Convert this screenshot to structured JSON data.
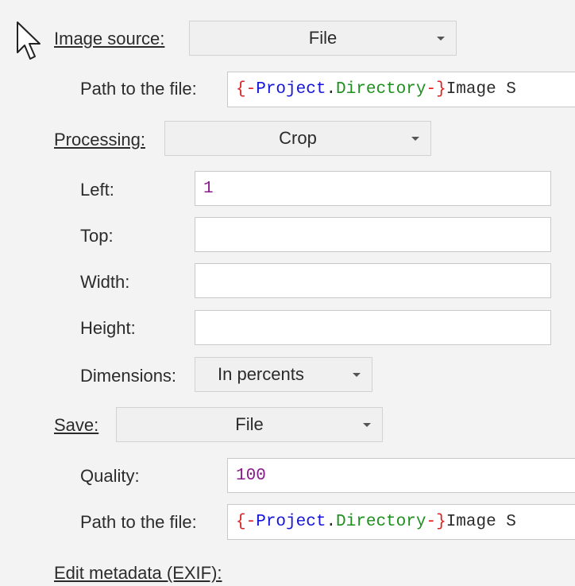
{
  "image_source": {
    "label": "Image source:",
    "value": "File",
    "path_label": "Path to the file:",
    "path": {
      "open": "{-",
      "project": "Project",
      "dot": ".",
      "directory": "Directory",
      "close": "-}",
      "rest": "Image S"
    }
  },
  "processing": {
    "label": "Processing:",
    "value": "Crop",
    "left_label": "Left:",
    "left_value": "1",
    "top_label": "Top:",
    "top_value": "",
    "width_label": "Width:",
    "width_value": "",
    "height_label": "Height:",
    "height_value": "",
    "dimensions_label": "Dimensions:",
    "dimensions_value": "In percents"
  },
  "save": {
    "label": "Save:",
    "value": "File",
    "quality_label": "Quality:",
    "quality_value": "100",
    "path_label": "Path to the file:",
    "path": {
      "open": "{-",
      "project": "Project",
      "dot": ".",
      "directory": "Directory",
      "close": "-}",
      "rest": "Image S"
    }
  },
  "edit_metadata_label": "Edit metadata (EXIF):",
  "colors": {
    "background": "#f3f3f3",
    "macro_brace": "#e02020",
    "macro_project": "#1515d8",
    "macro_directory": "#1f8f1f",
    "number_value": "#8b1a8b"
  },
  "cursor_icon": "mouse-pointer-icon"
}
